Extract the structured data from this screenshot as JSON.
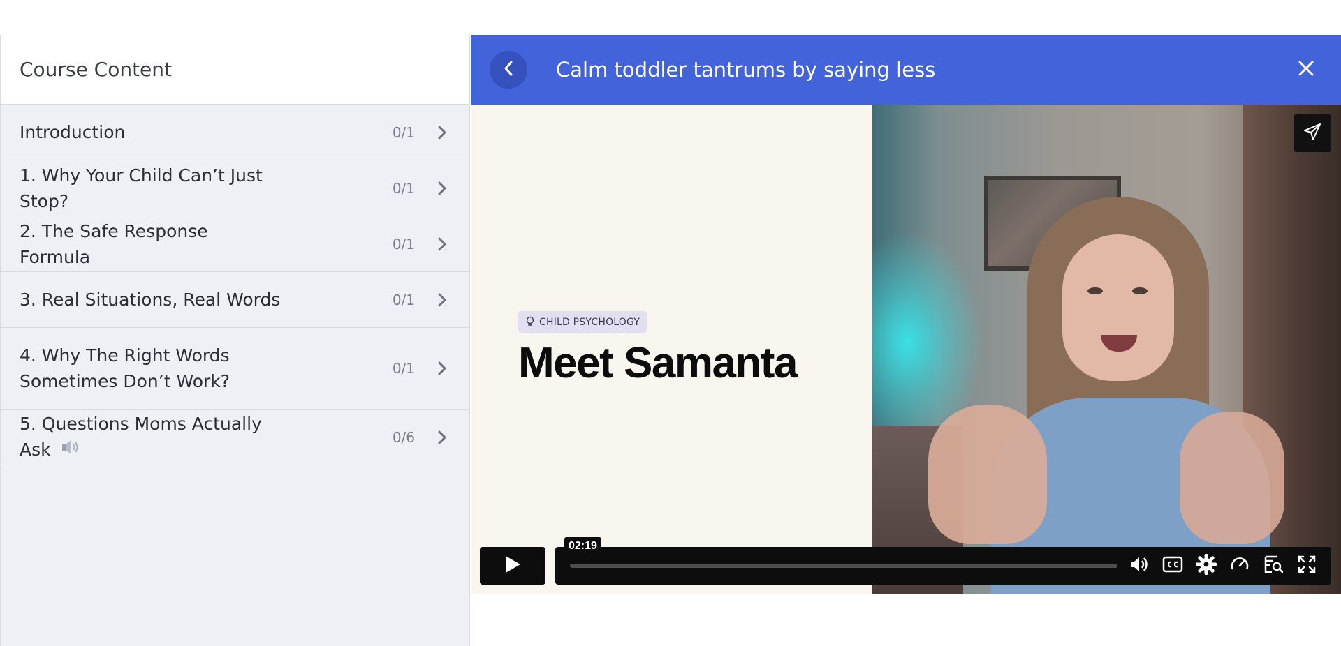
{
  "sidebar": {
    "title": "Course Content",
    "sections": [
      {
        "label": "Introduction",
        "count": "0/1"
      },
      {
        "label": "1. Why Your Child Can’t Just Stop?",
        "count": "0/1"
      },
      {
        "label": "2. The Safe Response Formula",
        "count": "0/1"
      },
      {
        "label": "3. Real Situations, Real Words",
        "count": "0/1"
      },
      {
        "label": "4. Why The Right Words Sometimes Don’t Work?",
        "count": "0/1"
      },
      {
        "label": "5. Questions Moms Actually Ask",
        "count": "0/6"
      }
    ]
  },
  "player": {
    "title": "Calm toddler tantrums by saying less",
    "slide": {
      "tag": "CHILD PSYCHOLOGY",
      "heading": "Meet Samanta"
    },
    "controls": {
      "time_tooltip": "02:19",
      "progress_fraction": 0.0
    }
  },
  "colors": {
    "header_bg": "#4263d9",
    "sidebar_bg": "#eef0f5",
    "control_bar_bg": "#0d0d0d"
  },
  "icons": [
    "chevron-right-icon",
    "speaker-icon",
    "back-arrow-icon",
    "close-icon",
    "send-icon",
    "play-icon",
    "volume-icon",
    "cc-icon",
    "gear-icon",
    "speedometer-icon",
    "transcript-icon",
    "fullscreen-icon"
  ]
}
